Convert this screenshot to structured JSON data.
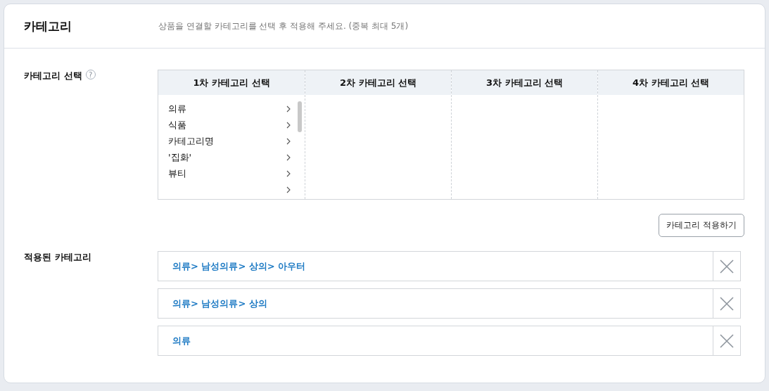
{
  "header": {
    "title": "카테고리",
    "description": "상품을 연결할 카테고리를 선택 후 적용해 주세요. (중복 최대 5개)"
  },
  "picker": {
    "label": "카테고리 선택",
    "help": "?",
    "columns": [
      {
        "heading": "1차 카테고리 선택",
        "items": [
          {
            "kind": "named",
            "label": "의류"
          },
          {
            "kind": "named",
            "label": "식품"
          },
          {
            "kind": "named",
            "label": "카테고리명"
          },
          {
            "kind": "named",
            "label": "'집화'"
          },
          {
            "kind": "named",
            "label": "뷰티"
          },
          {
            "kind": "blank"
          }
        ]
      },
      {
        "heading": "2차 카테고리 선택"
      },
      {
        "heading": "3차 카테고리 선택"
      },
      {
        "heading": "4차 카테고리 선택"
      }
    ],
    "apply_button": "카테고리 적용하기"
  },
  "applied": {
    "label": "적용된 카테고리",
    "items": [
      "의류> 남성의류> 상의> 아우터",
      "의류> 남성의류> 상의",
      "의류"
    ]
  }
}
